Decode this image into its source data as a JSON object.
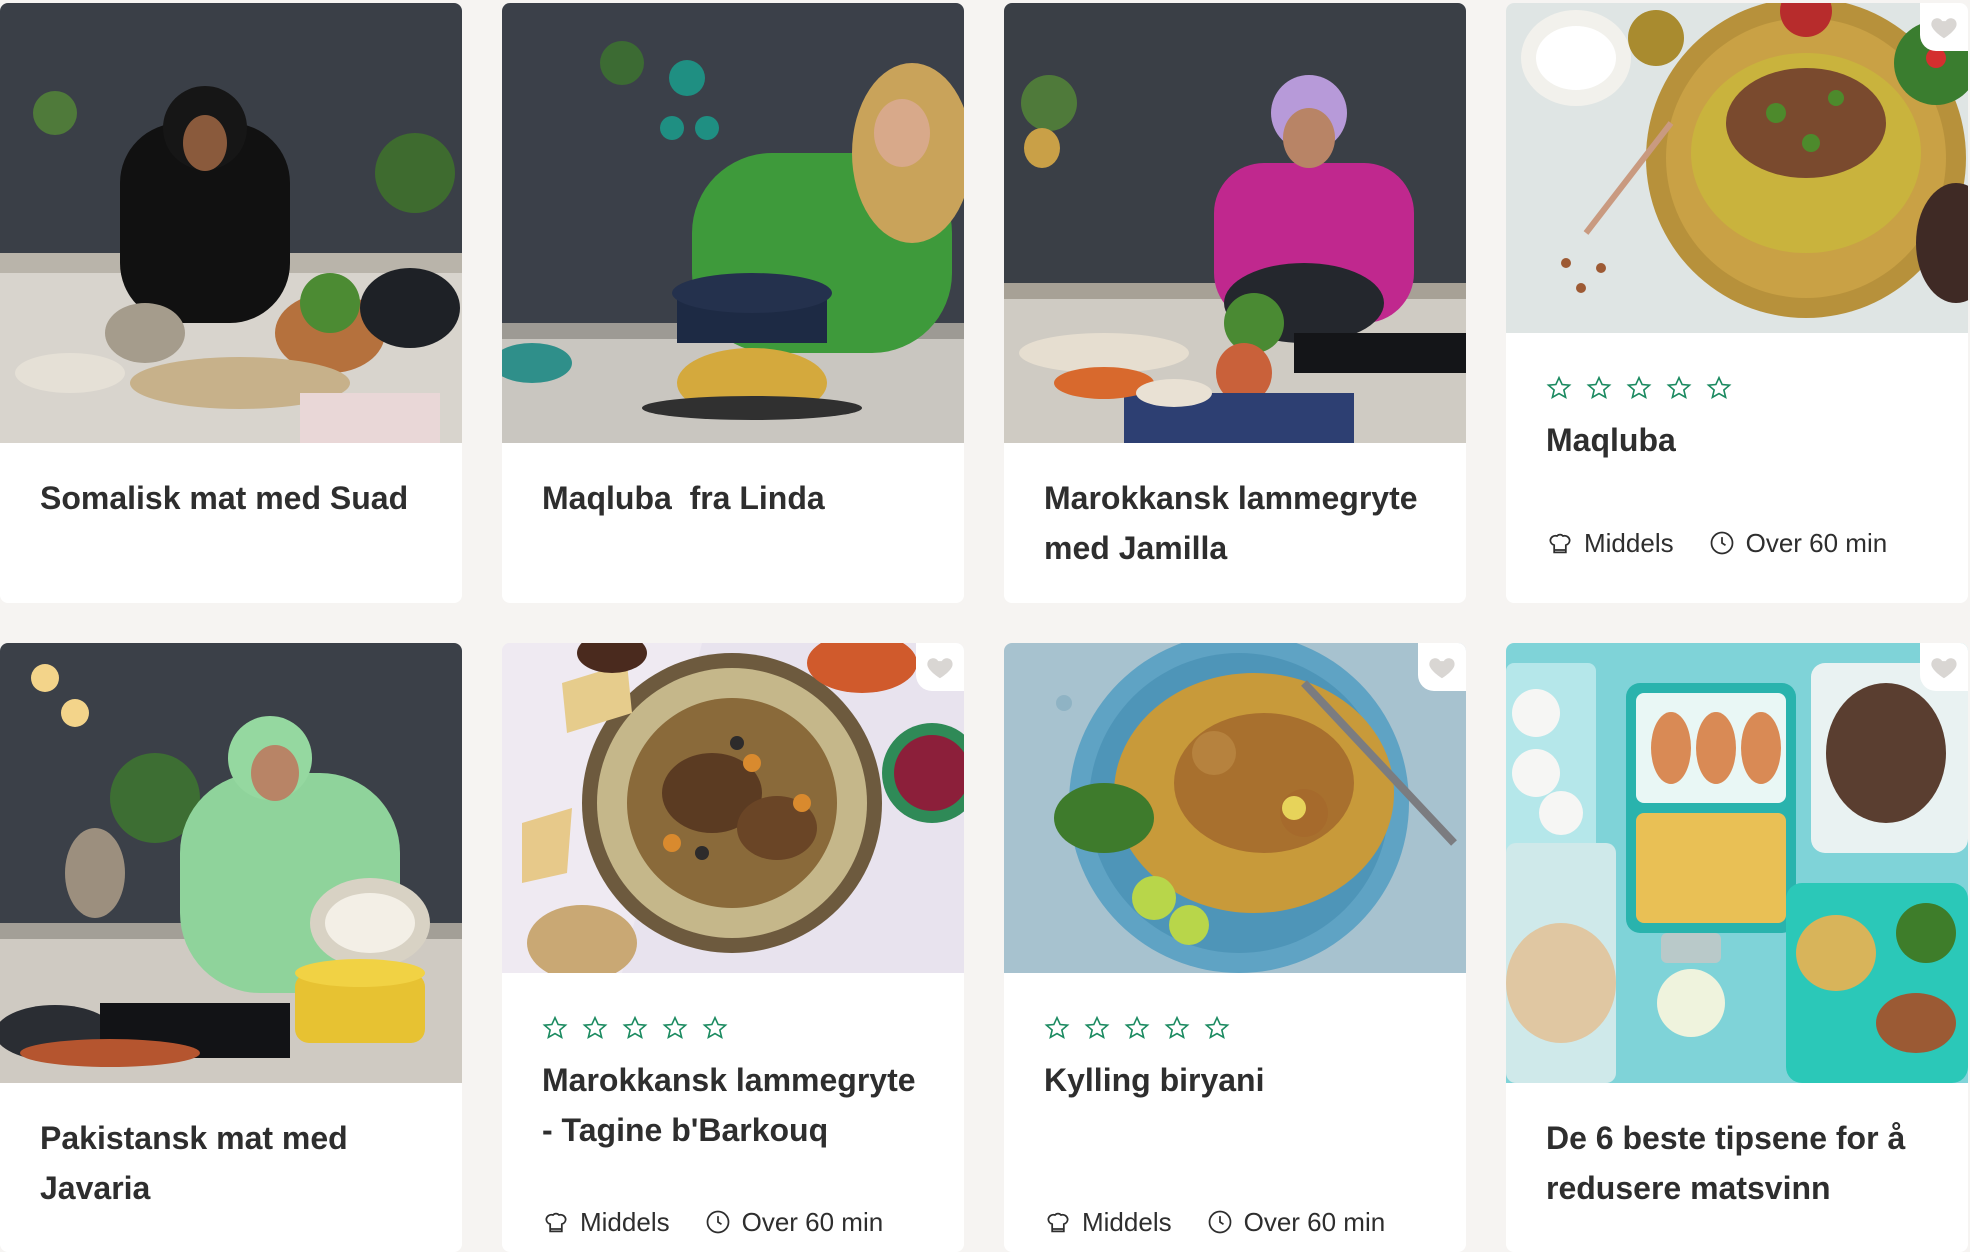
{
  "cards": [
    {
      "title": "Somalisk mat med Suad"
    },
    {
      "title": "Maqluba  fra Linda"
    },
    {
      "title": "Marokkansk lammegryte med Jamilla"
    },
    {
      "title": "Maqluba",
      "difficulty": "Middels",
      "time": "Over 60 min",
      "rating": 0,
      "max_rating": 5
    },
    {
      "title": "Pakistansk mat med Javaria"
    },
    {
      "title": "Marokkansk lammegryte - Tagine b'Barkouq",
      "difficulty": "Middels",
      "time": "Over 60 min",
      "rating": 0,
      "max_rating": 5
    },
    {
      "title": "Kylling biryani",
      "difficulty": "Middels",
      "time": "Over 60 min",
      "rating": 0,
      "max_rating": 5
    },
    {
      "title": "De 6 beste tipsene for å redusere matsvinn"
    }
  ],
  "colors": {
    "star": "#1b8a60",
    "page_bg": "#f6f4f2",
    "card_bg": "#ffffff",
    "heart": "#d9d6d3"
  },
  "icons": {
    "favorite": "heart-icon",
    "difficulty": "chef-hat-icon",
    "time": "clock-icon",
    "rating": "star-outline-icon"
  }
}
